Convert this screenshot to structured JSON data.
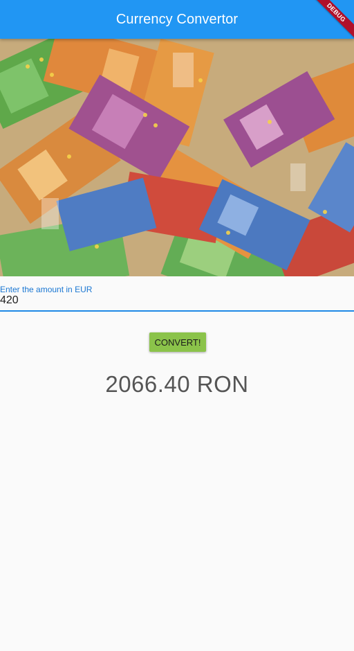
{
  "appbar": {
    "title": "Currency Convertor",
    "color": "#2196f3"
  },
  "debug_banner": {
    "label": "DEBUG",
    "color": "#b0102a"
  },
  "hero_image": {
    "subject": "pile of euro banknotes"
  },
  "amount_field": {
    "label": "Enter the amount in EUR",
    "value": "420",
    "accent_color": "#1e88e5"
  },
  "convert_button": {
    "label": "CONVERT!",
    "color": "#8bc34a"
  },
  "result": {
    "text": "2066.40 RON"
  }
}
